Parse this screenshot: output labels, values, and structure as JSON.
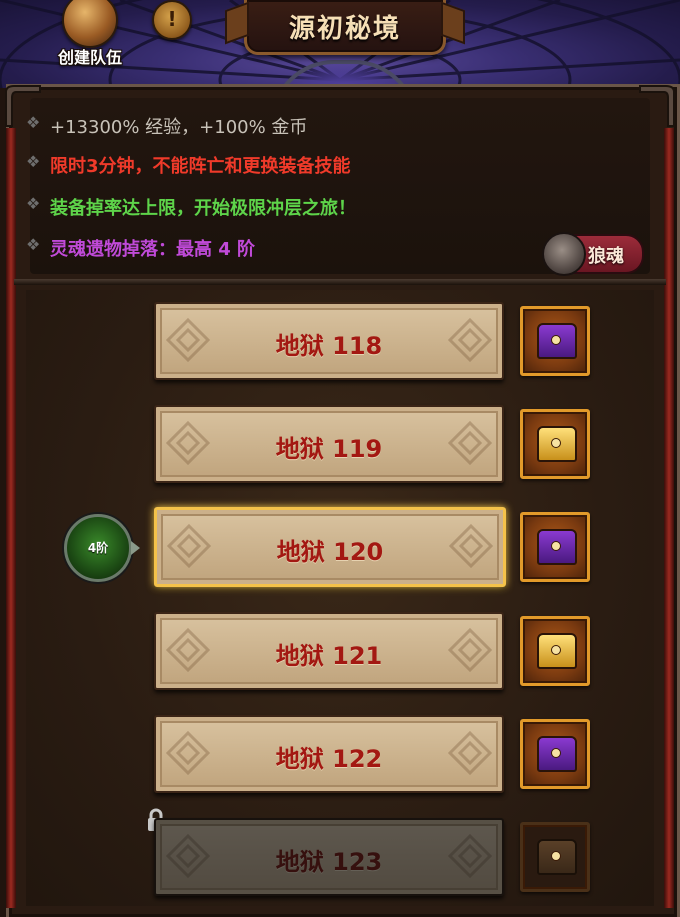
{
  "header": {
    "title": "源初秘境",
    "create_team_label": "创建队伍",
    "info_icon": "!"
  },
  "info": {
    "line1": "+13300% 经验，+100% 金币",
    "line2": "限时3分钟，不能阵亡和更换装备技能",
    "line3": "装备掉率达上限，开始极限冲层之旅！",
    "line4": "灵魂遗物掉落：最高 4 阶",
    "bullet": "❖",
    "wolf_soul_label": "狼魂"
  },
  "floors": [
    {
      "label": "地狱 118",
      "chest": "purple",
      "state": "normal"
    },
    {
      "label": "地狱 119",
      "chest": "gold",
      "state": "normal"
    },
    {
      "label": "地狱 120",
      "chest": "purple",
      "state": "selected"
    },
    {
      "label": "地狱 121",
      "chest": "gold",
      "state": "normal"
    },
    {
      "label": "地狱 122",
      "chest": "purple",
      "state": "normal"
    },
    {
      "label": "地狱 123",
      "chest": "gold",
      "state": "locked"
    }
  ],
  "tier_badge": "4阶",
  "colors": {
    "exp_line": "#c8c2b8",
    "warning_line": "#f03a2a",
    "drop_line": "#5ed44a",
    "relic_line": "#c04ad8",
    "floor_text": "#a31812",
    "selected_border": "#f4c24a"
  },
  "icons": {
    "team": "helmet-icon",
    "info": "exclamation-icon",
    "wolf": "wolf-head-icon",
    "tier": "green-soul-icon",
    "lock": "padlock-icon"
  }
}
